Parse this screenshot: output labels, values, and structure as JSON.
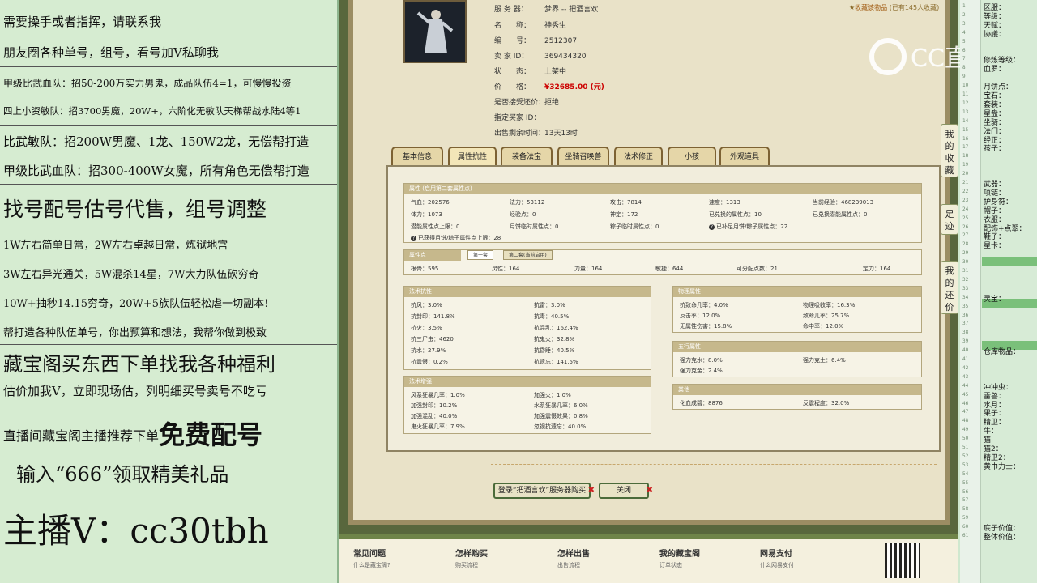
{
  "left_panel": {
    "lines": [
      "需要操手或者指挥，请联系我",
      "朋友圈各种单号，组号，看号加V私聊我",
      "甲级比武血队：招50-200万实力男鬼，成品队伍4=1，可慢慢投资",
      "四上小资敏队：招3700男魔，20W+，六阶化无敏队天梯帮战水陆4等1",
      "比武敏队：招200W男魔、1龙、150W2龙，无偿帮打造",
      "甲级比武血队：招300-400W女魔，所有角色无偿帮打造",
      "找号配号估号代售，组号调整",
      "1W左右简单日常，2W左右卓越日常，炼狱地宫",
      "3W左右异光通关，5W混杀14星，7W大力队伍砍穷奇",
      "10W+抽秒14.15穷奇，20W+5族队伍轻松虐一切副本!",
      "帮打造各种队伍单号，你出预算和想法，我帮你做到极致",
      "藏宝阁买东西下单找我各种福利",
      "估价加我V，立即现场估，列明细买号卖号不吃亏",
      "直播间藏宝阁主播推荐下单",
      "免费配号",
      "输入“666”领取精美礼品",
      "主播V：cc30tbh"
    ]
  },
  "item": {
    "server_label": "服 务 器：",
    "server_value": "梦界 -- 把酒言欢",
    "name_label": "名　　称：",
    "name_value": "神秀生",
    "id_label": "编　　号：",
    "id_value": "2512307",
    "seller_label": "卖 家 ID：",
    "seller_value": "369434320",
    "status_label": "状　　态：",
    "status_value": "上架中",
    "price_label": "价　　格：",
    "price_value": "¥32685.00 (元)",
    "bargain_label": "是否接受还价：",
    "bargain_value": "拒绝",
    "buyer_label": "指定买家 ID：",
    "buyer_value": "",
    "remaining_label": "出售剩余时间：",
    "remaining_value": "13天13时",
    "fav_text": "收藏该物品",
    "fav_count": "(已有145人收藏)"
  },
  "tabs": [
    "基本信息",
    "属性抗性",
    "装备法宝",
    "坐骑召唤兽",
    "法术修正",
    "小孩",
    "外观道具"
  ],
  "attr_section": {
    "header": "属性 (启用第二套属性点)",
    "rows": [
      [
        [
          "气血：202576",
          "法力：53112",
          "攻击：7814",
          "速度：1313",
          "当前经验：468239013"
        ]
      ],
      [
        [
          "体力：1073",
          "经验点：0",
          "神定：172",
          "已兑换的属性点：10",
          "已兑换潜能属性点：0"
        ]
      ],
      [
        [
          "潜能属性点上限：0",
          "月饼临时属性点：0",
          "粽子临时属性点：0",
          "已补足月饼/粽子属性点：22"
        ]
      ]
    ],
    "note": "已获得月饼/粽子属性点上限：28"
  },
  "points_section": {
    "header": "属性点",
    "subtab1": "第一套",
    "subtab2": "第二套(当前启用)",
    "values": [
      "根骨：595",
      "灵性：164",
      "力量：164",
      "敏捷：644",
      "可分配点数：21",
      "定力：164"
    ]
  },
  "resist_section": {
    "header": "法术抗性",
    "left": [
      "抗风：3.0%",
      "抗封印：141.8%",
      "抗火：3.5%",
      "抗三尸虫：4620",
      "抗水：27.9%",
      "抗震慑：0.2%"
    ],
    "right": [
      "抗雷：3.0%",
      "抗毒：40.5%",
      "抗混乱：162.4%",
      "抗鬼火：32.8%",
      "抗昏睡：40.5%",
      "抗遗忘：141.5%"
    ]
  },
  "boost_section": {
    "header": "法术增强",
    "left": [
      "风系狂暴几率：1.0%",
      "加强封印：10.2%",
      "加强混乱：40.0%",
      "鬼火狂暴几率：7.9%"
    ],
    "right": [
      "加强火：1.0%",
      "水系狂暴几率：6.0%",
      "加强震慑效果：0.8%",
      "忽视抗遗忘：40.0%"
    ]
  },
  "phys_section": {
    "header": "物理属性",
    "left": [
      "抗致命几率：4.0%",
      "反击率：12.0%",
      "无属性伤害：15.8%"
    ],
    "right": [
      "物理吸收率：16.3%",
      "致命几率：25.7%",
      "命中率：12.0%"
    ]
  },
  "wuxing_section": {
    "header": "五行属性",
    "left": [
      "强力克水：8.0%",
      "强力克金：2.4%"
    ],
    "right": [
      "强力克土：6.4%"
    ]
  },
  "other_section": {
    "header": "其他",
    "left": [
      "化血成碧：8876"
    ],
    "right": [
      "反震程度：32.0%"
    ]
  },
  "buttons": {
    "buy": "登录“把酒言欢”服务器购买",
    "close": "关闭"
  },
  "footer": {
    "cols": [
      "常见问题",
      "怎样购买",
      "怎样出售",
      "我的藏宝阁",
      "网易支付"
    ],
    "subs": [
      "什么是藏宝阁?",
      "购买流程",
      "出售流程",
      "订单状态",
      "什么网易支付"
    ]
  },
  "watermark": "CC直播",
  "vertical_tabs": [
    "我的收藏",
    "足迹",
    "我的还价"
  ],
  "right_panel": {
    "lines": [
      "区服：",
      "等级：",
      "天赋：",
      "协議：",
      "",
      "",
      "修炼等级：",
      "血罗：",
      "",
      "月饼点：",
      "宝石：",
      "套装：",
      "星盘：",
      "坐骑：",
      "法门：",
      "经正：",
      "孩子：",
      "",
      "",
      "",
      "武器：",
      "项链：",
      "护身符：",
      "帽子：",
      "衣服：",
      "配饰+点翠：",
      "鞋子：",
      "星卡：",
      "",
      "",
      "",
      "",
      "",
      "灵宝：",
      "",
      "",
      "",
      "",
      "",
      "仓库物品：",
      "",
      "",
      "",
      "冲冲虫：",
      "雷兽：",
      "水月：",
      "果子：",
      "精卫：",
      "牛：",
      "猫",
      "猫2：",
      "精卫2：",
      "黄巾力士：",
      "",
      "",
      "",
      "",
      "",
      "",
      "底子价值：",
      "整体价值："
    ],
    "highlight_color": "#7ac07a"
  }
}
